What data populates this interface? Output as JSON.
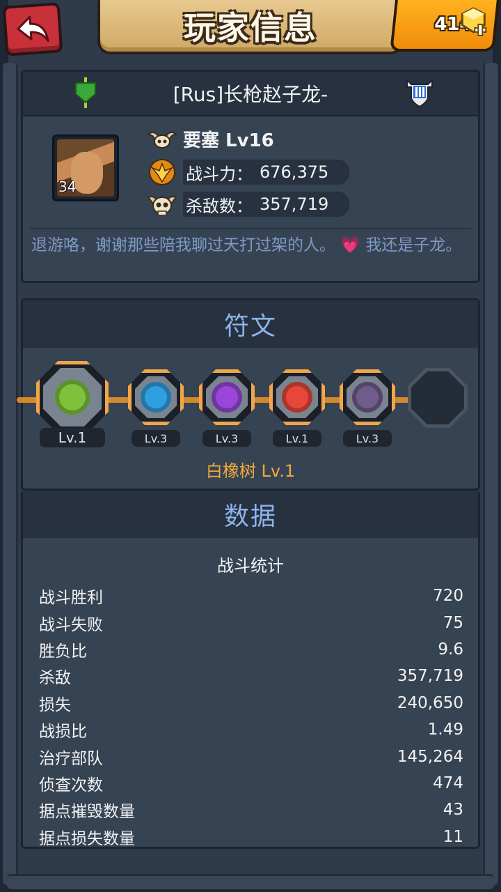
{
  "header": {
    "title": "玩家信息",
    "gems": "414"
  },
  "profile": {
    "name": "[Rus]长枪赵子龙-",
    "avatar_level": "34",
    "fortress_label": "要塞 Lv16",
    "power_label": "战斗力：",
    "power_value": "676,375",
    "kills_label": "杀敌数：",
    "kills_value": "357,719",
    "bio_part1": "退游咯，谢谢那些陪我聊过天打过架的人。",
    "bio_heart": "💗",
    "bio_part2": "我还是子龙。"
  },
  "runes": {
    "title": "符文",
    "items": [
      {
        "level": "Lv.1",
        "color": "#7dc23a"
      },
      {
        "level": "Lv.3",
        "color": "#2f9fe0"
      },
      {
        "level": "Lv.3",
        "color": "#9a46d8"
      },
      {
        "level": "Lv.1",
        "color": "#e8463a"
      },
      {
        "level": "Lv.3",
        "color": "#6f5c8a"
      }
    ],
    "selected_name": "白橡树 Lv.1"
  },
  "data": {
    "title": "数据",
    "battle_label": "战斗统计",
    "stats": [
      {
        "label": "战斗胜利",
        "value": "720"
      },
      {
        "label": "战斗失败",
        "value": "75"
      },
      {
        "label": "胜负比",
        "value": "9.6"
      },
      {
        "label": "杀敌",
        "value": "357,719"
      },
      {
        "label": "损失",
        "value": "240,650"
      },
      {
        "label": "战损比",
        "value": "1.49"
      },
      {
        "label": "治疗部队",
        "value": "145,264"
      },
      {
        "label": "侦查次数",
        "value": "474"
      },
      {
        "label": "据点摧毁数量",
        "value": "43"
      },
      {
        "label": "据点损失数量",
        "value": "11"
      }
    ]
  }
}
